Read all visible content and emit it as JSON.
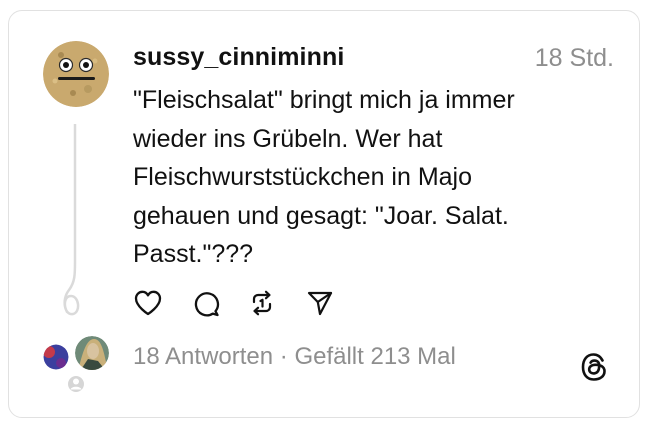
{
  "post": {
    "username": "sussy_cinniminni",
    "timestamp": "18 Std.",
    "text": "\"Fleischsalat\" bringt mich ja immer\nwieder ins Grübeln. Wer hat\nFleischwurststückchen in Majo\ngehauen und gesagt: \"Joar. Salat.\nPasst.\"???"
  },
  "stats": {
    "replies": "18 Antworten",
    "separator": " · ",
    "likes": "Gefällt 213 Mal"
  },
  "icons": {
    "like": "heart-icon",
    "comment": "speech-bubble-icon",
    "repost": "repost-icon",
    "share": "send-icon",
    "brand": "threads-logo-icon"
  },
  "colors": {
    "text": "#111111",
    "muted": "#8e8e8e",
    "border": "#e1e1e1",
    "thread_line": "#dadada"
  }
}
